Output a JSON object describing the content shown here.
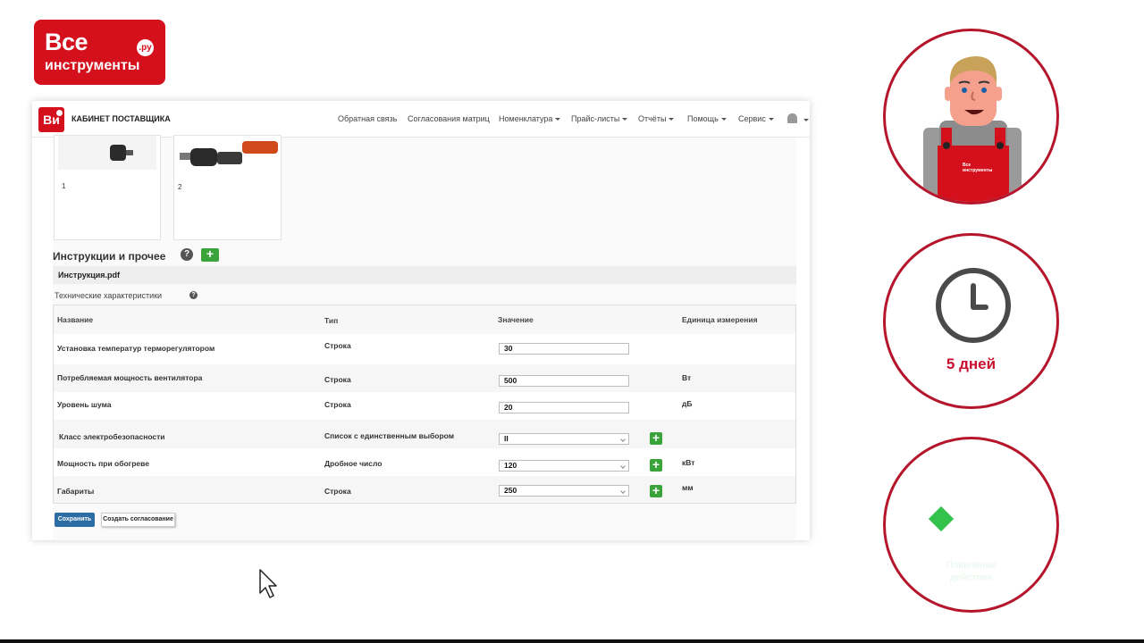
{
  "brand": {
    "line1": "Все",
    "line2": "инструменты",
    "ru": ".ру"
  },
  "app": {
    "logo": "Ви",
    "title": "КАБИНЕТ ПОСТАВЩИКА",
    "nav": [
      {
        "label": "Обратная связь",
        "dropdown": false
      },
      {
        "label": "Согласования матриц",
        "dropdown": false
      },
      {
        "label": "Номенклатура",
        "dropdown": true
      },
      {
        "label": "Прайс-листы",
        "dropdown": true
      },
      {
        "label": "Отчёты",
        "dropdown": true
      },
      {
        "label": "Помощь",
        "dropdown": true
      },
      {
        "label": "Сервис",
        "dropdown": true
      }
    ]
  },
  "images": [
    {
      "num": "1"
    },
    {
      "num": "2"
    }
  ],
  "instructions": {
    "title": "Инструкции и прочее",
    "help": "?",
    "add": "+",
    "file": "Инструкция.pdf"
  },
  "tech": {
    "title": "Технические характеристики",
    "help": "?",
    "headers": {
      "name": "Название",
      "type": "Тип",
      "value": "Значение",
      "unit": "Единица измерения"
    },
    "rows": [
      {
        "name": "Установка температур терморегулятором",
        "type": "Строка",
        "value": "30",
        "unit": "",
        "select": false,
        "add": false
      },
      {
        "name": "Потребляемая мощность вентилятора",
        "type": "Строка",
        "value": "500",
        "unit": "Вт",
        "select": false,
        "add": false
      },
      {
        "name": "Уровень шума",
        "type": "Строка",
        "value": "20",
        "unit": "дБ",
        "select": false,
        "add": false
      },
      {
        "name": "Класс электробезопасности",
        "type": "Список с единственным выбором",
        "value": "II",
        "unit": "",
        "select": true,
        "add": true
      },
      {
        "name": "Мощность при обогреве",
        "type": "Дробное число",
        "value": "120",
        "unit": "кВт",
        "select": true,
        "add": true
      },
      {
        "name": "Габариты",
        "type": "Строка",
        "value": "250",
        "unit": "мм",
        "select": true,
        "add": true
      }
    ]
  },
  "buttons": {
    "save": "Сохранить",
    "create": "Создать согласование"
  },
  "circles": {
    "mascot_shirt": "Все инструменты",
    "days": "5 дней",
    "faint_line1": "Появление",
    "faint_line2": "действия"
  },
  "colors": {
    "brand_red": "#d4101c",
    "circle_border": "#b5162b",
    "save_blue": "#2e6da4",
    "add_green": "#3aa33a",
    "diamond_green": "#35c24c"
  }
}
